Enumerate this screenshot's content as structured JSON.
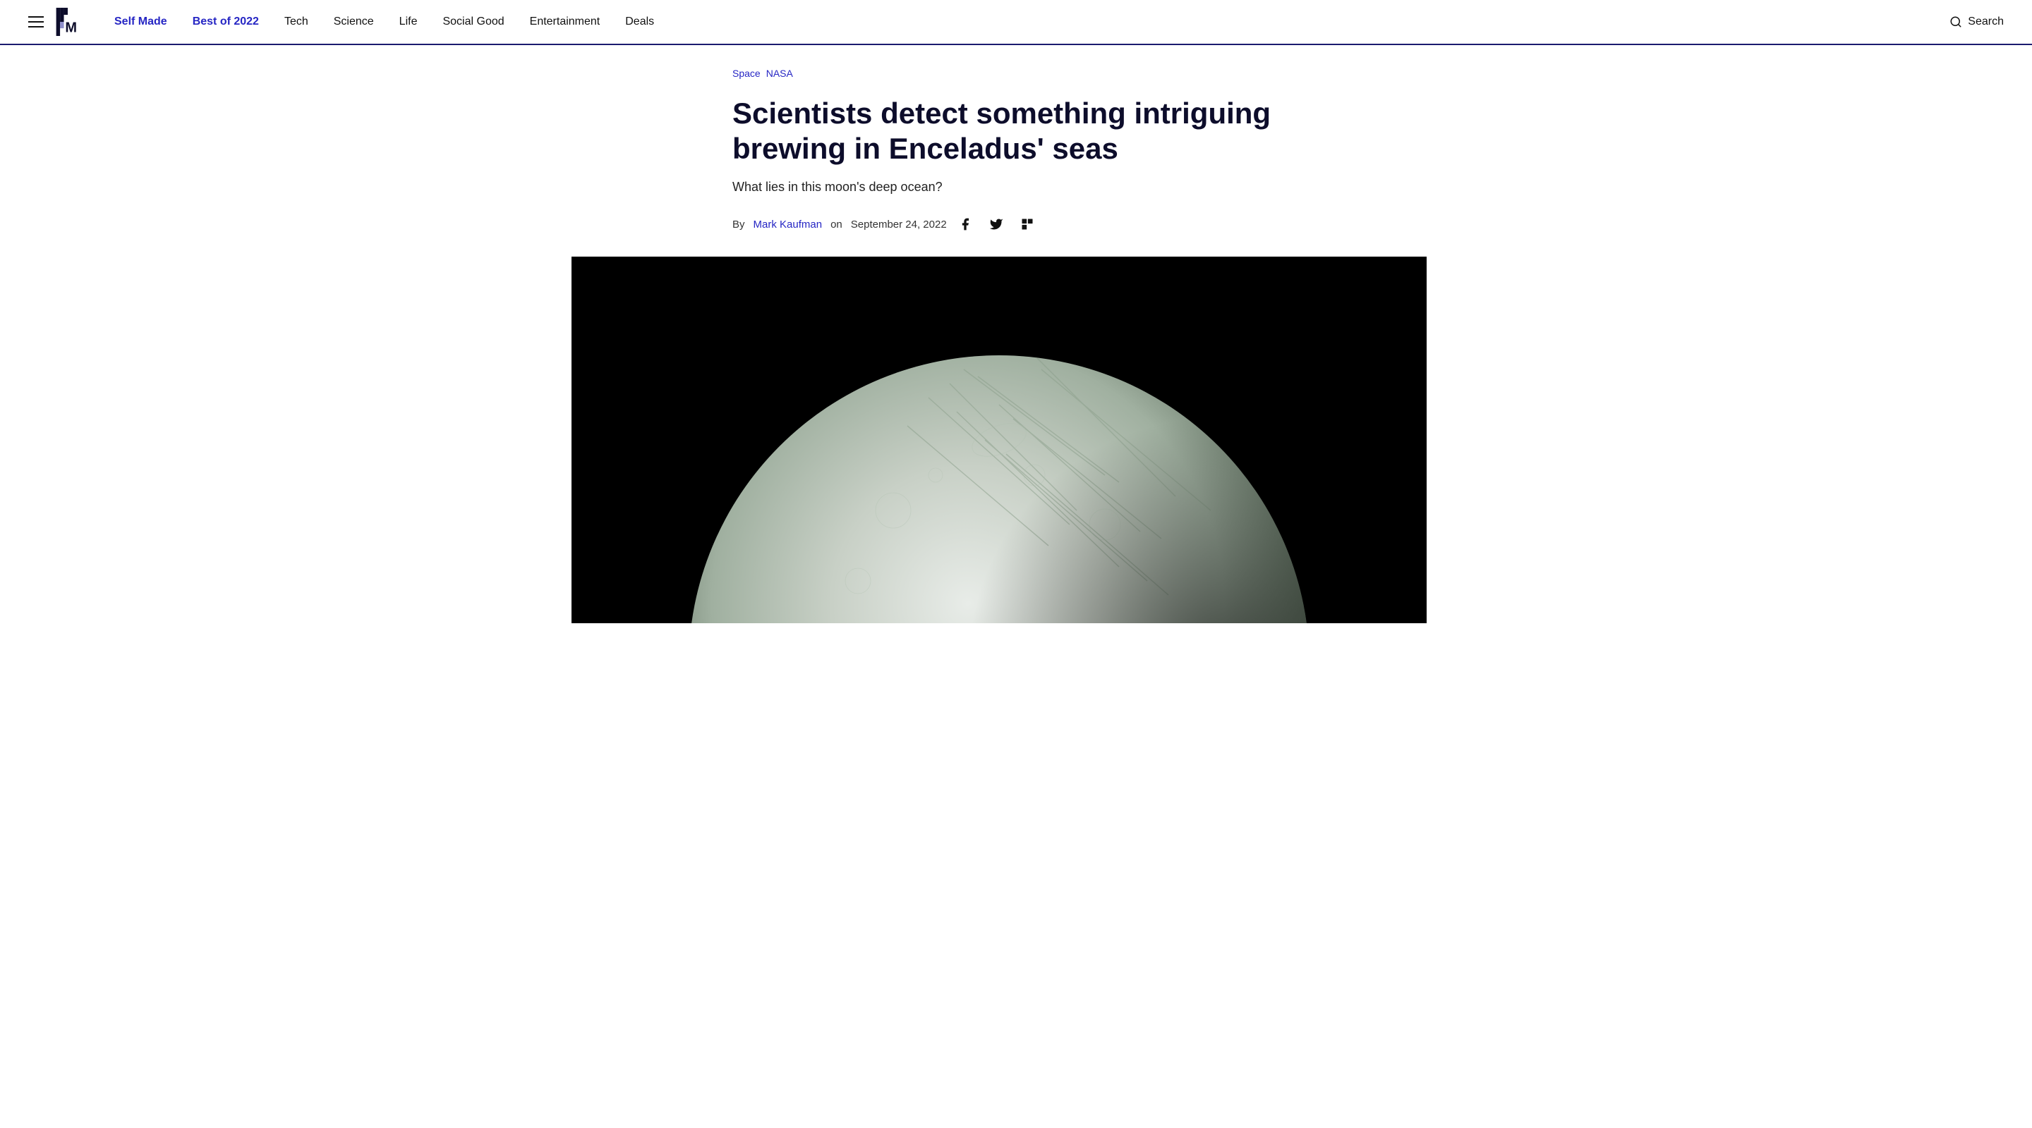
{
  "nav": {
    "hamburger_label": "Menu",
    "logo_text": "M",
    "links": [
      {
        "label": "Self Made",
        "active": true,
        "id": "self-made"
      },
      {
        "label": "Best of 2022",
        "active": true,
        "id": "best-of-2022"
      },
      {
        "label": "Tech",
        "active": false,
        "id": "tech"
      },
      {
        "label": "Science",
        "active": false,
        "id": "science"
      },
      {
        "label": "Life",
        "active": false,
        "id": "life"
      },
      {
        "label": "Social Good",
        "active": false,
        "id": "social-good"
      },
      {
        "label": "Entertainment",
        "active": false,
        "id": "entertainment"
      },
      {
        "label": "Deals",
        "active": false,
        "id": "deals"
      }
    ],
    "search_label": "Search"
  },
  "breadcrumb": [
    {
      "label": "Space",
      "href": "#"
    },
    {
      "label": "NASA",
      "href": "#"
    }
  ],
  "article": {
    "title": "Scientists detect something intriguing brewing in Enceladus' seas",
    "subtitle": "What lies in this moon's deep ocean?",
    "byline_prefix": "By",
    "author": "Mark Kaufman",
    "date_prefix": "on",
    "date": "September 24, 2022"
  },
  "social": {
    "facebook_label": "Share on Facebook",
    "twitter_label": "Share on Twitter",
    "flipboard_label": "Share on Flipboard"
  },
  "colors": {
    "accent": "#2626c4",
    "title": "#0d0d2b",
    "body_text": "#222"
  }
}
